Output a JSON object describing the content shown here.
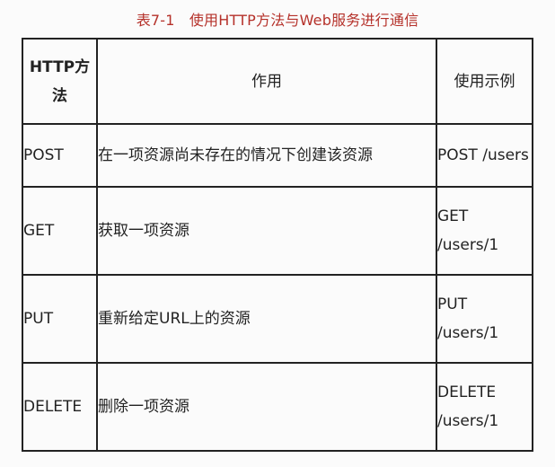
{
  "caption": "表7-1　使用HTTP方法与Web服务进行通信",
  "table": {
    "headers": {
      "method": "HTTP方法",
      "purpose": "作用",
      "example": "使用示例"
    },
    "rows": [
      {
        "method": "POST",
        "purpose": "在一项资源尚未存在的情况下创建该资源",
        "example": "POST /users"
      },
      {
        "method": "GET",
        "purpose": "获取一项资源",
        "example": "GET /users/1"
      },
      {
        "method": "PUT",
        "purpose": "重新给定URL上的资源",
        "example": "PUT /users/1"
      },
      {
        "method": "DELETE",
        "purpose": "删除一项资源",
        "example": "DELETE /users/1"
      }
    ]
  }
}
